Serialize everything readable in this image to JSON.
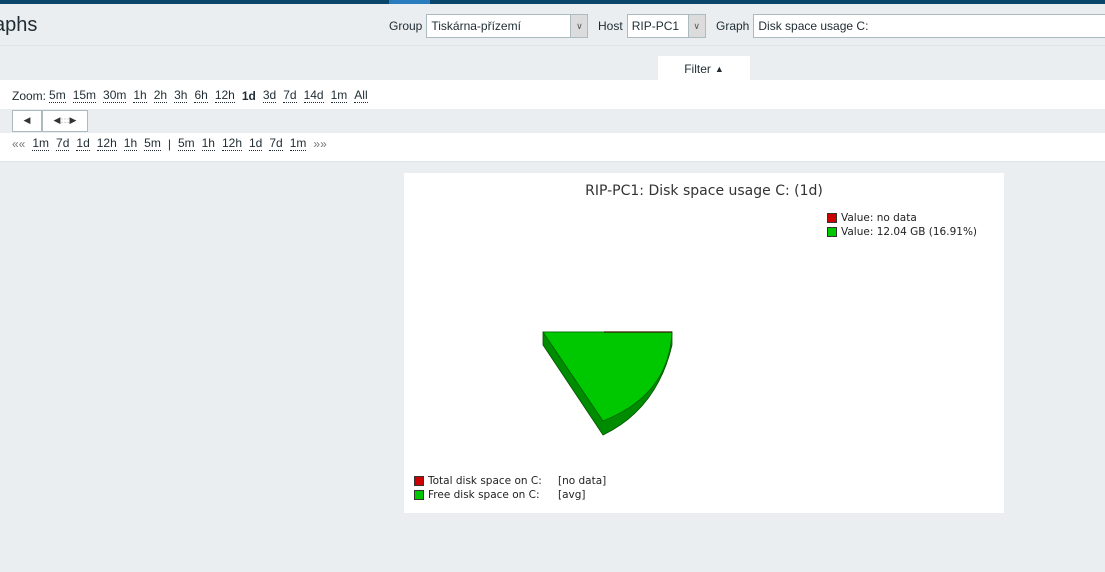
{
  "header": {
    "title": "aphs",
    "group_label": "Group",
    "group_value": "Tiskárna-přízemí",
    "host_label": "Host",
    "host_value": "RIP-PC1",
    "graph_label": "Graph",
    "graph_value": "Disk space usage C:"
  },
  "filter": {
    "label": "Filter",
    "icon": "triangle-up-icon"
  },
  "zoom": {
    "label": "Zoom:",
    "options": [
      "5m",
      "15m",
      "30m",
      "1h",
      "2h",
      "3h",
      "6h",
      "12h",
      "1d",
      "3d",
      "7d",
      "14d",
      "1m",
      "All"
    ],
    "selected": "1d"
  },
  "nav": {
    "back": "««",
    "back_links": [
      "1m",
      "7d",
      "1d",
      "12h",
      "1h",
      "5m"
    ],
    "sep": "|",
    "fwd_links": [
      "5m",
      "1h",
      "12h",
      "1d",
      "7d",
      "1m"
    ],
    "fwd": "»»"
  },
  "chart_data": {
    "type": "pie",
    "title": "RIP-PC1: Disk space usage C: (1d)",
    "slices": [
      {
        "name": "Total disk space on C:",
        "func": "[no data]",
        "value_label": "Value: no data",
        "value": null,
        "color": "#cc0000"
      },
      {
        "name": "Free disk space on C:",
        "func": "[avg]",
        "value_label": "Value: 12.04 GB (16.91%)",
        "value": 12.04,
        "unit": "GB",
        "percent": 16.91,
        "color": "#00c800"
      }
    ]
  }
}
